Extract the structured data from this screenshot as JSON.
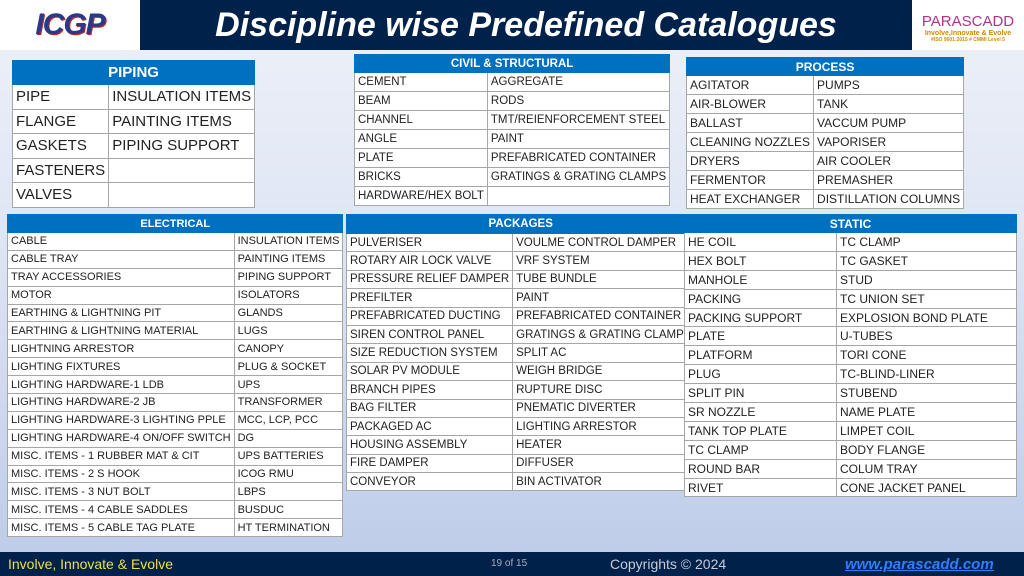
{
  "header": {
    "title": "Discipline wise Predefined Catalogues",
    "logo_left": "ICGP",
    "logo_right_name": "PARASCADD",
    "logo_right_tagline": "Involve,Innovate & Evolve",
    "logo_right_iso": "#ISO 9001:2015 # CMMI Level 5"
  },
  "tables": {
    "piping": {
      "title": "PIPING",
      "rows": [
        [
          "PIPE",
          "INSULATION ITEMS"
        ],
        [
          "FLANGE",
          "PAINTING ITEMS"
        ],
        [
          "GASKETS",
          "PIPING SUPPORT"
        ],
        [
          "FASTENERS",
          ""
        ],
        [
          "VALVES",
          ""
        ]
      ]
    },
    "civil": {
      "title": "CIVIL & STRUCTURAL",
      "rows": [
        [
          "CEMENT",
          "AGGREGATE"
        ],
        [
          "BEAM",
          "RODS"
        ],
        [
          "CHANNEL",
          "TMT/REIENFORCEMENT STEEL"
        ],
        [
          "ANGLE",
          "PAINT"
        ],
        [
          "PLATE",
          "PREFABRICATED CONTAINER"
        ],
        [
          "BRICKS",
          "GRATINGS & GRATING CLAMPS"
        ],
        [
          "HARDWARE/HEX BOLT",
          ""
        ]
      ]
    },
    "process": {
      "title": "PROCESS",
      "rows": [
        [
          "AGITATOR",
          "PUMPS"
        ],
        [
          "AIR-BLOWER",
          "TANK"
        ],
        [
          "BALLAST",
          "VACCUM PUMP"
        ],
        [
          "CLEANING NOZZLES",
          "VAPORISER"
        ],
        [
          "DRYERS",
          "AIR COOLER"
        ],
        [
          "FERMENTOR",
          "PREMASHER"
        ],
        [
          "HEAT EXCHANGER",
          "DISTILLATION COLUMNS"
        ]
      ]
    },
    "electrical": {
      "title": "ELECTRICAL",
      "rows": [
        [
          "CABLE",
          "INSULATION ITEMS"
        ],
        [
          "CABLE TRAY",
          "PAINTING ITEMS"
        ],
        [
          "TRAY ACCESSORIES",
          "PIPING SUPPORT"
        ],
        [
          "MOTOR",
          "ISOLATORS"
        ],
        [
          "EARTHING & LIGHTNING PIT",
          "GLANDS"
        ],
        [
          "EARTHING & LIGHTNING MATERIAL",
          "LUGS"
        ],
        [
          "LIGHTNING ARRESTOR",
          "CANOPY"
        ],
        [
          "LIGHTING FIXTURES",
          "PLUG & SOCKET"
        ],
        [
          "LIGHTING HARDWARE-1 LDB",
          "UPS"
        ],
        [
          "LIGHTING HARDWARE-2 JB",
          "TRANSFORMER"
        ],
        [
          "LIGHTING HARDWARE-3 LIGHTING PPLE",
          "MCC, LCP, PCC"
        ],
        [
          "LIGHTING HARDWARE-4 ON/OFF SWITCH",
          "DG"
        ],
        [
          "MISC. ITEMS - 1 RUBBER MAT & CIT",
          "UPS BATTERIES"
        ],
        [
          "MISC. ITEMS - 2 S HOOK",
          "ICOG RMU"
        ],
        [
          "MISC. ITEMS - 3 NUT BOLT",
          "LBPS"
        ],
        [
          "MISC. ITEMS - 4 CABLE SADDLES",
          "BUSDUC"
        ],
        [
          "MISC. ITEMS - 5 CABLE TAG PLATE",
          "HT TERMINATION"
        ]
      ]
    },
    "packages": {
      "title": "PACKAGES",
      "rows": [
        [
          "PULVERISER",
          "VOULME CONTROL DAMPER"
        ],
        [
          "ROTARY AIR LOCK VALVE",
          "VRF SYSTEM"
        ],
        [
          "PRESSURE RELIEF DAMPER",
          "TUBE BUNDLE"
        ],
        [
          "PREFILTER",
          "PAINT"
        ],
        [
          "PREFABRICATED DUCTING",
          "PREFABRICATED CONTAINER"
        ],
        [
          "SIREN CONTROL PANEL",
          "GRATINGS & GRATING CLAMPS"
        ],
        [
          "SIZE REDUCTION SYSTEM",
          "SPLIT AC"
        ],
        [
          "SOLAR PV MODULE",
          "WEIGH BRIDGE"
        ],
        [
          "BRANCH PIPES",
          "RUPTURE DISC"
        ],
        [
          "BAG FILTER",
          "PNEMATIC DIVERTER"
        ],
        [
          "PACKAGED AC",
          "LIGHTING ARRESTOR"
        ],
        [
          "HOUSING ASSEMBLY",
          "HEATER"
        ],
        [
          "FIRE DAMPER",
          "DIFFUSER"
        ],
        [
          "CONVEYOR",
          "BIN ACTIVATOR"
        ]
      ]
    },
    "static": {
      "title": "STATIC",
      "rows": [
        [
          "HE COIL",
          "TC CLAMP"
        ],
        [
          "HEX BOLT",
          "TC GASKET"
        ],
        [
          "MANHOLE",
          "STUD"
        ],
        [
          "PACKING",
          "TC UNION SET"
        ],
        [
          "PACKING SUPPORT",
          "EXPLOSION BOND PLATE"
        ],
        [
          "PLATE",
          "U-TUBES"
        ],
        [
          "PLATFORM",
          "TORI CONE"
        ],
        [
          "PLUG",
          "TC-BLIND-LINER"
        ],
        [
          "SPLIT PIN",
          "STUBEND"
        ],
        [
          "SR NOZZLE",
          "NAME PLATE"
        ],
        [
          "TANK TOP PLATE",
          "LIMPET COIL"
        ],
        [
          "TC CLAMP",
          "BODY FLANGE"
        ],
        [
          "ROUND BAR",
          "COLUM TRAY"
        ],
        [
          "RIVET",
          "CONE JACKET PANEL"
        ]
      ]
    }
  },
  "footer": {
    "tagline": "Involve, Innovate & Evolve",
    "page": "19 of 15",
    "copyright": "Copyrights © 2024",
    "website": "www.parascadd.com"
  },
  "colors": {
    "header_bg": "#00214a",
    "table_header": "#0070c0",
    "tagline": "#f0e040",
    "link": "#2f7fff"
  }
}
